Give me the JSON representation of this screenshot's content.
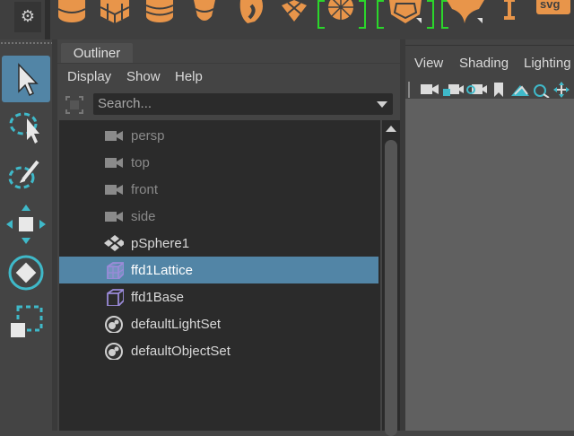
{
  "shelf": {
    "icons": [
      "gear-icon",
      "cylinder-icon",
      "cube-icon",
      "cylinder-icon",
      "cone-icon",
      "torus-icon",
      "plane-icon",
      "sphere-icon",
      "polyhedron-icon",
      "diamond-icon",
      "type-icon",
      "svg-icon"
    ],
    "svg_label": "svg"
  },
  "toolbox": {
    "tools": [
      "select-tool-icon",
      "lasso-tool-icon",
      "paint-select-icon",
      "move-tool-icon",
      "rotate-tool-icon",
      "scale-tool-icon"
    ]
  },
  "outliner": {
    "tab_label": "Outliner",
    "menu": [
      "Display",
      "Show",
      "Help"
    ],
    "search": {
      "placeholder": "Search..."
    },
    "items": [
      {
        "label": "persp",
        "icon": "camera-icon",
        "dim": true,
        "selected": false
      },
      {
        "label": "top",
        "icon": "camera-icon",
        "dim": true,
        "selected": false
      },
      {
        "label": "front",
        "icon": "camera-icon",
        "dim": true,
        "selected": false
      },
      {
        "label": "side",
        "icon": "camera-icon",
        "dim": true,
        "selected": false
      },
      {
        "label": "pSphere1",
        "icon": "mesh-transform-icon",
        "dim": false,
        "selected": false
      },
      {
        "label": "ffd1Lattice",
        "icon": "lattice-icon",
        "dim": false,
        "selected": true
      },
      {
        "label": "ffd1Base",
        "icon": "lattice-icon",
        "dim": false,
        "selected": false
      },
      {
        "label": "defaultLightSet",
        "icon": "set-icon",
        "dim": false,
        "selected": false
      },
      {
        "label": "defaultObjectSet",
        "icon": "set-icon",
        "dim": false,
        "selected": false
      }
    ]
  },
  "viewport": {
    "menu": [
      "View",
      "Shading",
      "Lighting"
    ],
    "icons": [
      "camera-icon",
      "camera-lock-icon",
      "camera-attributes-icon",
      "bookmark-icon",
      "image-plane-icon",
      "grease-pencil-icon",
      "pan-zoom-icon"
    ]
  },
  "colors": {
    "accent": "#5285a6",
    "icon_orange": "#e8954a",
    "lattice_purple": "#9a8ad8",
    "bracket_green": "#2bd62b",
    "tool_cyan": "#3fb9c9"
  }
}
